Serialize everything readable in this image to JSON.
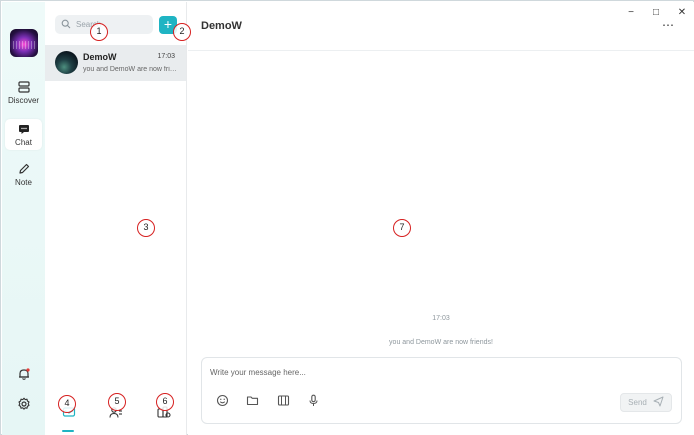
{
  "window": {
    "minimize": "−",
    "maximize": "□",
    "close": "✕"
  },
  "rail": {
    "items": [
      {
        "label": "Discover",
        "icon": "discover-icon"
      },
      {
        "label": "Chat",
        "icon": "chat-bubble-icon"
      },
      {
        "label": "Note",
        "icon": "note-pen-icon"
      }
    ],
    "bottom": [
      {
        "icon": "bell-icon"
      },
      {
        "icon": "gear-icon"
      }
    ]
  },
  "conversations": {
    "search_placeholder": "Search",
    "add_label": "+",
    "items": [
      {
        "name": "DemoW",
        "time": "17:03",
        "preview": "you and DemoW are now frie..."
      }
    ],
    "bottom_tabs": [
      {
        "icon": "messages-icon",
        "active": true
      },
      {
        "icon": "contacts-icon",
        "active": false
      },
      {
        "icon": "groups-settings-icon",
        "active": false
      }
    ]
  },
  "chat": {
    "title": "DemoW",
    "more_label": "⋯",
    "timestamp": "17:03",
    "system_message": "you and DemoW are now friends!",
    "composer_placeholder": "Write your message here...",
    "send_label": "Send",
    "tools": [
      "emoji-icon",
      "folder-icon",
      "image-gallery-icon",
      "microphone-icon"
    ]
  },
  "annotations": [
    "1",
    "2",
    "3",
    "4",
    "5",
    "6",
    "7"
  ],
  "colors": {
    "accent": "#1fb4c3",
    "marker": "#d62020",
    "rail_bg": "#eaf8f7"
  }
}
